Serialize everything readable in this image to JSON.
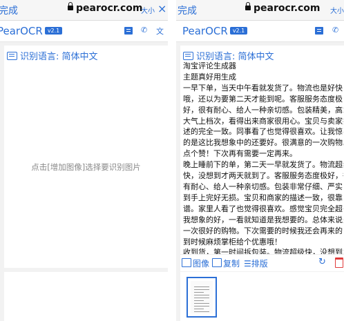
{
  "browser": {
    "done_label": "完成",
    "url": "pearocr.com",
    "text_size_label": "大小",
    "close_label": "×"
  },
  "app": {
    "name": "PearOCR",
    "version": "v2.1"
  },
  "ocr_panel": {
    "language_label": "识别语言: 简体中文",
    "empty_hint": "点击[增加图像]选择要识别图片",
    "result_lines": [
      "淘宝评论生成器",
      "主题真好用生成",
      "一早下单，当天中午看就发货了。物流也是好快",
      "哦，还以为要第二天才能到呢。客服服务态度极",
      "好，很有耐心、给人一种亲切感。包装精美，高端",
      "大气上档次，看得出来商家很用心。宝贝与卖家描",
      "述的完全一致。同事看了也觉得很喜欢。让我惊喜",
      "的是这比我想象中的还要好。很满意的一次购物。",
      "点个赞！下次再有需要一定再来。",
      "晚上睡前下的单，第二天一早就发货了。物流超级",
      "快，没想到才两天就到了。客服服务态度极好，很",
      "有耐心、给人一种亲切感。包装非常仔细、严实",
      "到手上完好无损。宝贝和商家的描述一致，很靠",
      "谱。家里人看了也觉得很喜欢。感觉宝贝完全超乎",
      "我想象的好，一看就知道是我想要的。总体来说是",
      "一次很好的购物。下次需要的时候我还会再来的",
      "到时候麻烦掌柜给个优惠哦！",
      "收到货，第一时间拆包装。物流超级快，没想到才"
    ]
  },
  "toolbar": {
    "image_label": "图像",
    "copy_label": "复制",
    "layout_label": "排版"
  },
  "colors": {
    "accent": "#2b6fd6",
    "danger": "#e03b3b"
  }
}
